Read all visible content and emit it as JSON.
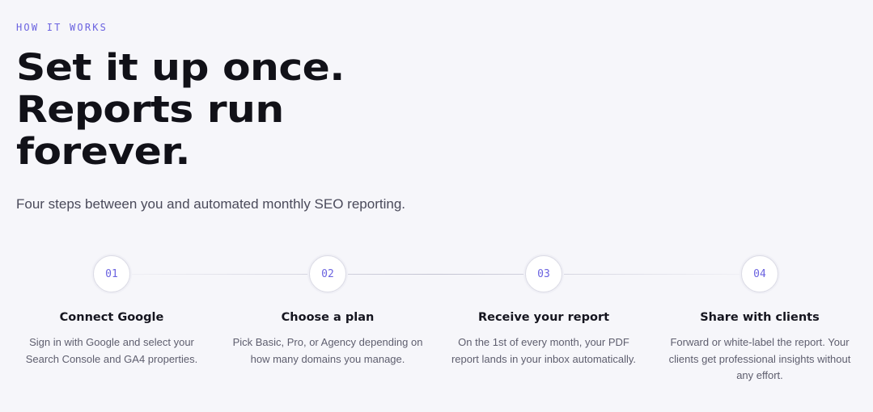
{
  "section": {
    "eyebrow": "HOW IT WORKS",
    "headline": [
      "Set it up once.",
      "Reports run",
      "forever."
    ],
    "subtitle": "Four steps between you and automated monthly SEO reporting."
  },
  "steps": [
    {
      "number": "01",
      "title": "Connect Google",
      "description": "Sign in with Google and select your Search Console and GA4 properties."
    },
    {
      "number": "02",
      "title": "Choose a plan",
      "description": "Pick Basic, Pro, or Agency depending on how many domains you manage."
    },
    {
      "number": "03",
      "title": "Receive your report",
      "description": "On the 1st of every month, your PDF report lands in your inbox automatically."
    },
    {
      "number": "04",
      "title": "Share with clients",
      "description": "Forward or white-label the report. Your clients get professional insights without any effort."
    }
  ],
  "colors": {
    "accent": "#6b63e0",
    "background": "#f6f6fa",
    "heading": "#111118",
    "body_text": "#5e5e6e"
  }
}
